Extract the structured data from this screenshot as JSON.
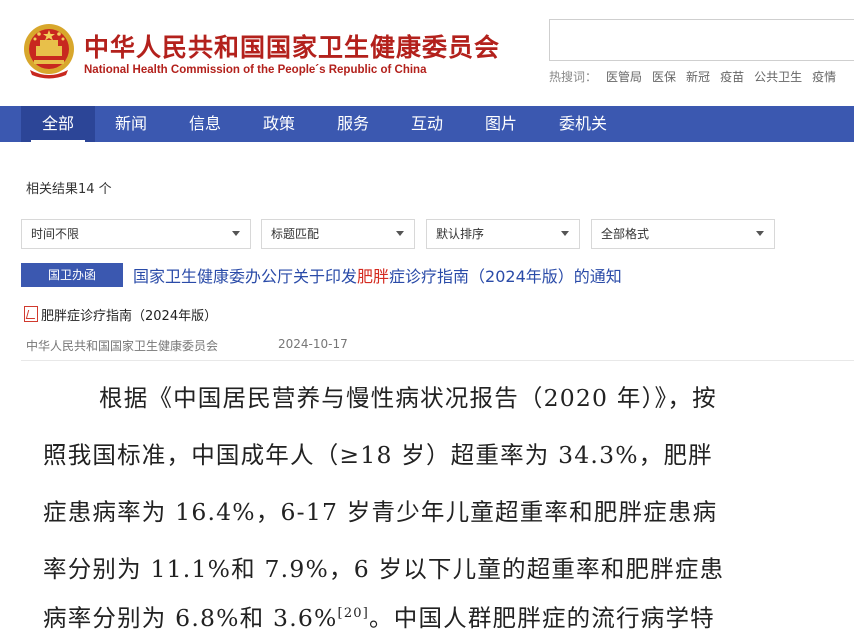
{
  "header": {
    "title_cn": "中华人民共和国国家卫生健康委员会",
    "title_en": "National Health Commission of the People´s Republic of China",
    "hot_label": "热搜词：",
    "hot_terms": [
      "医管局",
      "医保",
      "新冠",
      "疫苗",
      "公共卫生",
      "疫情"
    ]
  },
  "nav": {
    "items": [
      "全部",
      "新闻",
      "信息",
      "政策",
      "服务",
      "互动",
      "图片",
      "委机关"
    ],
    "active": "全部"
  },
  "results": {
    "count_text": "相关结果14 个",
    "filters": [
      "时间不限",
      "标题匹配",
      "默认排序",
      "全部格式"
    ],
    "item": {
      "tag": "国卫办函",
      "title_pre": "国家卫生健康委办公厅关于印发",
      "title_hl": "肥胖",
      "title_post": "症诊疗指南（2024年版）的通知",
      "attachment": "肥胖症诊疗指南（2024年版）",
      "source": "中华人民共和国国家卫生健康委员会",
      "date": "2024-10-17"
    }
  },
  "preview": {
    "line1": "根据《中国居民营养与慢性病状况报告（2020 年）》，按",
    "line2": "照我国标准，中国成年人（≥18 岁）超重率为 34.3%，肥胖",
    "line3": "症患病率为 16.4%，6-17 岁青少年儿童超重率和肥胖症患病",
    "line4": "率分别为 11.1%和 7.9%，6 岁以下儿童的超重率和肥胖症患",
    "line5_pre": "病率分别为 6.8%和 3.6%",
    "line5_sup": "[20]",
    "line5_post": "。中国人群肥胖症的流行病学特"
  }
}
